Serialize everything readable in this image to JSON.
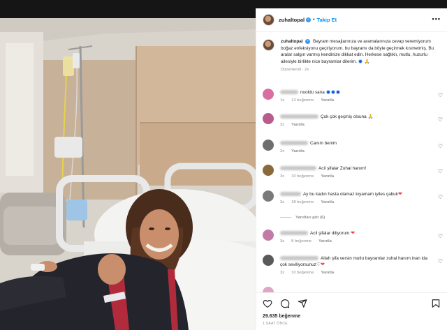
{
  "post": {
    "username": "zuhaltopal",
    "follow_label": "Takip Et",
    "more_label": "•••",
    "caption": "Bayram mesajlarınıza ve aramalarınıza cevap veremiyorum boğaz enfeksiyonu geçiriyorum. bu bayramı da böyle geçirmek kısmetmiş. Bu aralar salgın varmış kendinize dikkat edin. Herkese sağlıklı, mutlu, huzurlu ailesiyle birlikte nice bayramlar dilerim.",
    "caption_meta": "Düzenlendi · 2s",
    "likes": "29.635 beğenme",
    "time": "1 SAAT ÖNCE"
  },
  "comments": [
    {
      "text": "nooldu sana",
      "meta_time": "1s",
      "likes": "13 beğenme",
      "reply": "Yanıtla",
      "emoji": "circles",
      "avatar_color": "#d86fa0"
    },
    {
      "text": "Çok çok geçmiş olsuna",
      "meta_time": "2s",
      "likes": "",
      "reply": "Yanıtla",
      "emoji": "pray",
      "avatar_color": "#b75c8c"
    },
    {
      "text": "Canım benim",
      "meta_time": "2s",
      "likes": "",
      "reply": "Yanıtla",
      "emoji": "",
      "avatar_color": "#6e6e6e"
    },
    {
      "text": "Acil şifalar Zuhal hanım!",
      "meta_time": "3s",
      "likes": "10 beğenme",
      "reply": "Yanıtla",
      "emoji": "",
      "avatar_color": "#8a6a3c"
    },
    {
      "text": "Ay bu kadın hasta olamaz kıyamam iyiles çabuk",
      "meta_time": "3s",
      "likes": "18 beğenme",
      "reply": "Yanıtla",
      "emoji": "heart",
      "avatar_color": "#7a7a7a"
    },
    {
      "text": "Acil şifalar diliyorum",
      "meta_time": "3s",
      "likes": "8 beğenme",
      "reply": "Yanıtla",
      "emoji": "heart",
      "avatar_color": "#c37aa6"
    },
    {
      "text": "Allah şifa versin mutlu bayramlar zuhal hanım inan ida çok seviliyorsunuz",
      "meta_time": "3s",
      "likes": "10 beğenme",
      "reply": "Yanıtla",
      "emoji": "hearts2",
      "avatar_color": "#5a5a5a"
    }
  ],
  "view_replies": "Yanıtları gör (6)",
  "icons": [
    "heart-icon",
    "comment-icon",
    "share-icon",
    "bookmark-icon",
    "verified-icon",
    "more-icon"
  ],
  "colors": {
    "follow": "#0095f6",
    "verified": "#3897f0",
    "heart": "#ed4956",
    "meta": "#8e8e8e"
  }
}
